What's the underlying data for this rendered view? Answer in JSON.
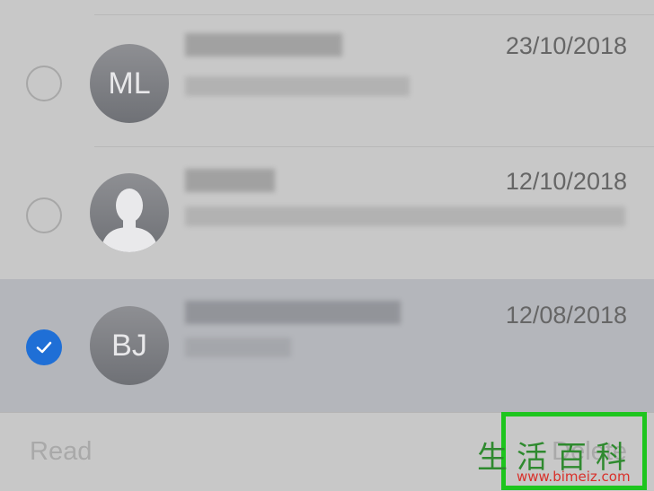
{
  "messages": [
    {
      "initials": "ML",
      "date": "23/10/2018",
      "selected": false,
      "avatar": "initials"
    },
    {
      "initials": "",
      "date": "12/10/2018",
      "selected": false,
      "avatar": "person-silhouette-icon"
    },
    {
      "initials": "BJ",
      "date": "12/08/2018",
      "selected": true,
      "avatar": "initials"
    }
  ],
  "toolbar": {
    "read_label": "Read",
    "delete_label": "Delete"
  },
  "watermark": {
    "chars": "生活百科",
    "url": "www.bimeiz.com"
  },
  "colors": {
    "checked_blue": "#1f6fd6",
    "highlight_green": "#1ec51e",
    "selected_row": "#b4b6bb",
    "background": "#c8c8c8"
  }
}
